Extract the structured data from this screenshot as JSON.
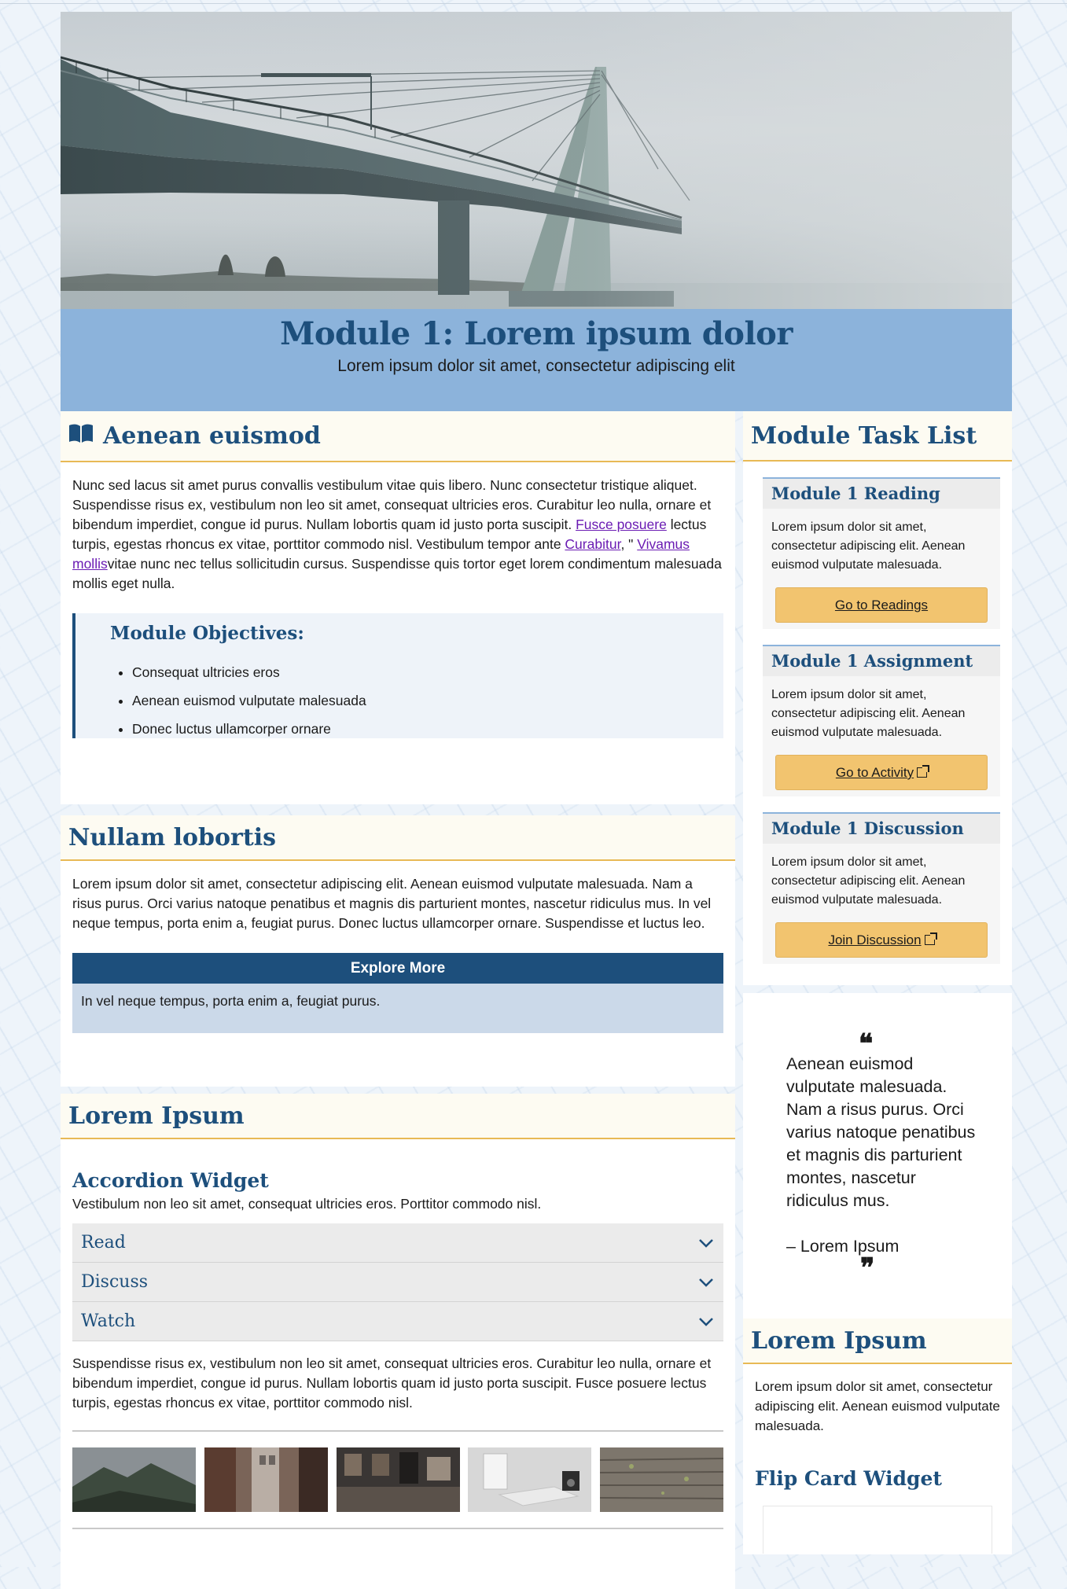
{
  "hero": {
    "title": "Module 1: Lorem ipsum dolor",
    "subtitle": "Lorem ipsum dolor sit amet, consectetur adipiscing elit"
  },
  "section1": {
    "heading": "Aenean euismod",
    "p_part1": "Nunc sed lacus sit amet purus convallis vestibulum vitae quis libero. Nunc consectetur tristique aliquet. Suspendisse risus ex, vestibulum non leo sit amet, consequat ultricies eros. Curabitur leo nulla, ornare et bibendum imperdiet, congue id purus. Nullam lobortis quam id justo porta suscipit. ",
    "link1": "Fusce posuere",
    "p_part2": " lectus turpis, egestas rhoncus ex vitae, porttitor commodo nisl. Vestibulum tempor ante ",
    "link2": "Curabitur",
    "p_part3": ", \" ",
    "link3": "Vivamus mollis",
    "p_part4": "vitae nunc nec tellus sollicitudin cursus. Suspendisse quis tortor eget lorem condimentum malesuada mollis eget nulla.",
    "objectives_title": "Module Objectives:",
    "objectives": [
      "Consequat ultricies eros",
      "Aenean euismod vulputate malesuada",
      "Donec luctus ullamcorper ornare"
    ]
  },
  "section2": {
    "heading": "Nullam lobortis",
    "paragraph": "Lorem ipsum dolor sit amet, consectetur adipiscing elit. Aenean euismod vulputate malesuada. Nam a risus purus. Orci varius natoque penatibus et magnis dis parturient montes, nascetur ridiculus mus. In vel neque tempus, porta enim a, feugiat purus. Donec luctus ullamcorper ornare. Suspendisse et luctus leo.",
    "explore_title": "Explore More",
    "explore_text": "In vel neque tempus, porta enim a, feugiat purus."
  },
  "section3": {
    "heading": "Lorem Ipsum",
    "accordion_title": "Accordion Widget",
    "accordion_intro": "Vestibulum non leo sit amet, consequat ultricies eros. Porttitor commodo nisl.",
    "accordion_items": [
      "Read",
      "Discuss",
      "Watch"
    ],
    "after_text": "Suspendisse risus ex, vestibulum non leo sit amet, consequat ultricies eros. Curabitur leo nulla, ornare et bibendum imperdiet, congue id purus. Nullam lobortis quam id justo porta suscipit. Fusce posuere lectus turpis, egestas rhoncus ex vitae, porttitor commodo nisl."
  },
  "tasks": {
    "heading": "Module Task List",
    "items": [
      {
        "title": "Module 1 Reading",
        "text": "Lorem ipsum dolor sit amet, consectetur adipiscing elit. Aenean euismod vulputate malesuada.",
        "button": "Go to Readings",
        "external": false
      },
      {
        "title": "Module 1 Assignment",
        "text": "Lorem ipsum dolor sit amet, consectetur adipiscing elit. Aenean euismod vulputate malesuada.",
        "button": "Go to Activity",
        "external": true
      },
      {
        "title": "Module 1 Discussion",
        "text": "Lorem ipsum dolor sit amet, consectetur adipiscing elit. Aenean euismod vulputate malesuada.",
        "button": "Join Discussion",
        "external": true
      }
    ]
  },
  "quote": {
    "text": "Aenean euismod vulputate malesuada. Nam a risus purus. Orci varius natoque penatibus et magnis dis parturient montes, nascetur ridiculus mus.",
    "author": "– Lorem Ipsum",
    "open_mark": "❝",
    "close_mark": "❞"
  },
  "side_section": {
    "heading": "Lorem Ipsum",
    "text": "Lorem ipsum dolor sit amet, consectetur adipiscing elit. Aenean euismod vulputate malesuada.",
    "flip_title": "Flip Card Widget"
  },
  "colors": {
    "brand_blue": "#1d4f7c",
    "banner_blue": "#8cb3db",
    "accent_gold": "#e8b955",
    "button_gold": "#f2c46f"
  },
  "icons": {
    "section_icon": "open-book-icon",
    "accordion_toggle": "chevron-down-icon",
    "external_link": "external-link-icon"
  }
}
